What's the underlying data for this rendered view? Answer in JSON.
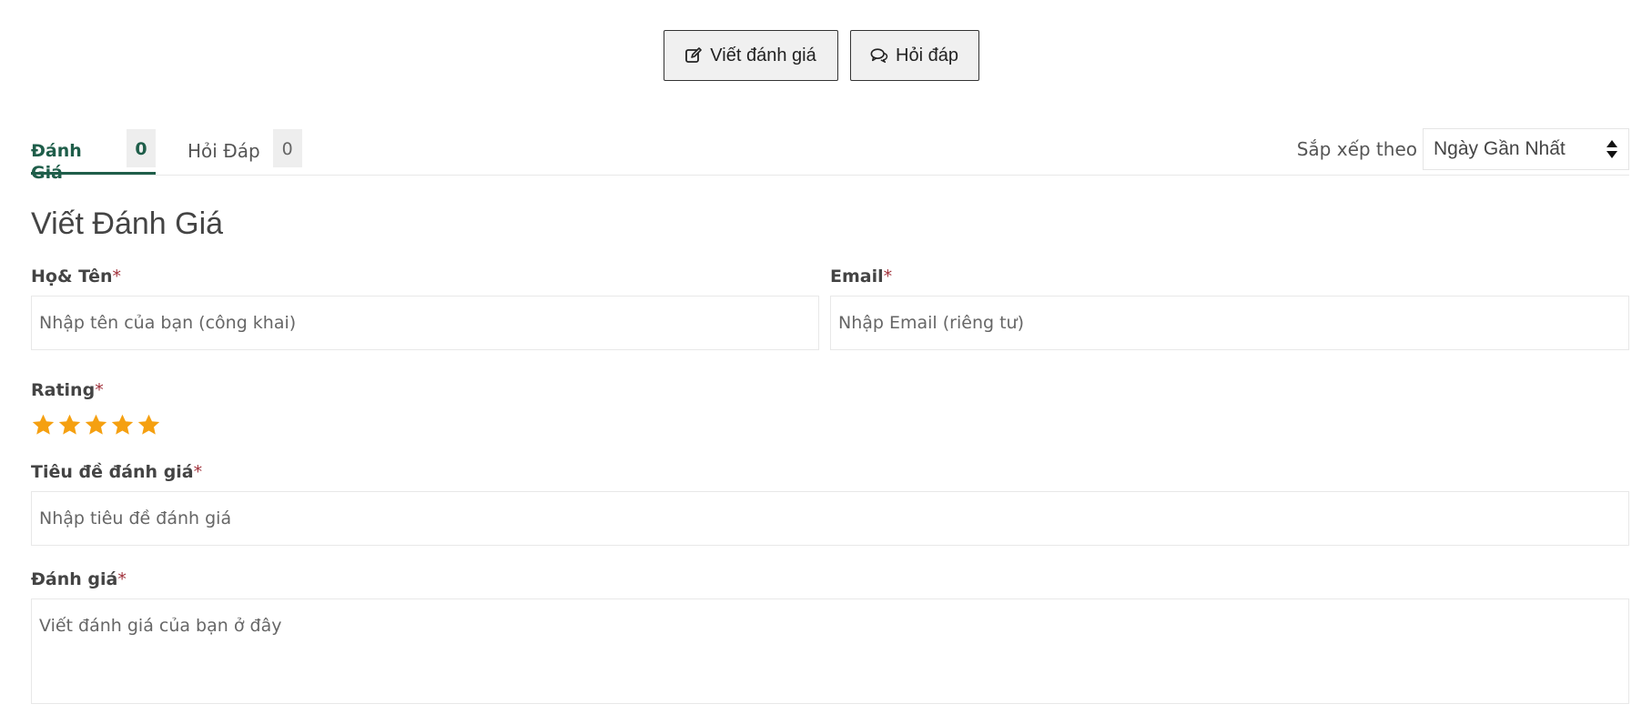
{
  "actions": {
    "write_review_label": "Viết đánh giá",
    "qa_label": "Hỏi đáp"
  },
  "tabs": [
    {
      "label": "Đánh Giá",
      "count": "0",
      "active": true
    },
    {
      "label": "Hỏi Đáp",
      "count": "0",
      "active": false
    }
  ],
  "sort": {
    "label": "Sắp xếp theo",
    "selected": "Ngày Gần Nhất"
  },
  "form": {
    "title": "Viết Đánh Giá",
    "name_label": "Họ& Tên",
    "name_placeholder": "Nhập tên của bạn (công khai)",
    "email_label": "Email",
    "email_placeholder": "Nhập Email (riêng tư)",
    "rating_label": "Rating",
    "rating_value": 5,
    "rating_max": 5,
    "review_title_label": "Tiêu đề đánh giá",
    "review_title_placeholder": "Nhập tiêu đề đánh giá",
    "review_body_label": "Đánh giá",
    "review_body_placeholder": "Viết đánh giá của bạn ở đây",
    "required_mark": "*"
  },
  "colors": {
    "accent": "#1f5e4a",
    "star": "#f5a011",
    "required": "#a0303a"
  },
  "icons": {
    "write": "edit-icon",
    "qa": "chat-icon",
    "sort": "sort-updown-icon",
    "star": "star-icon"
  }
}
